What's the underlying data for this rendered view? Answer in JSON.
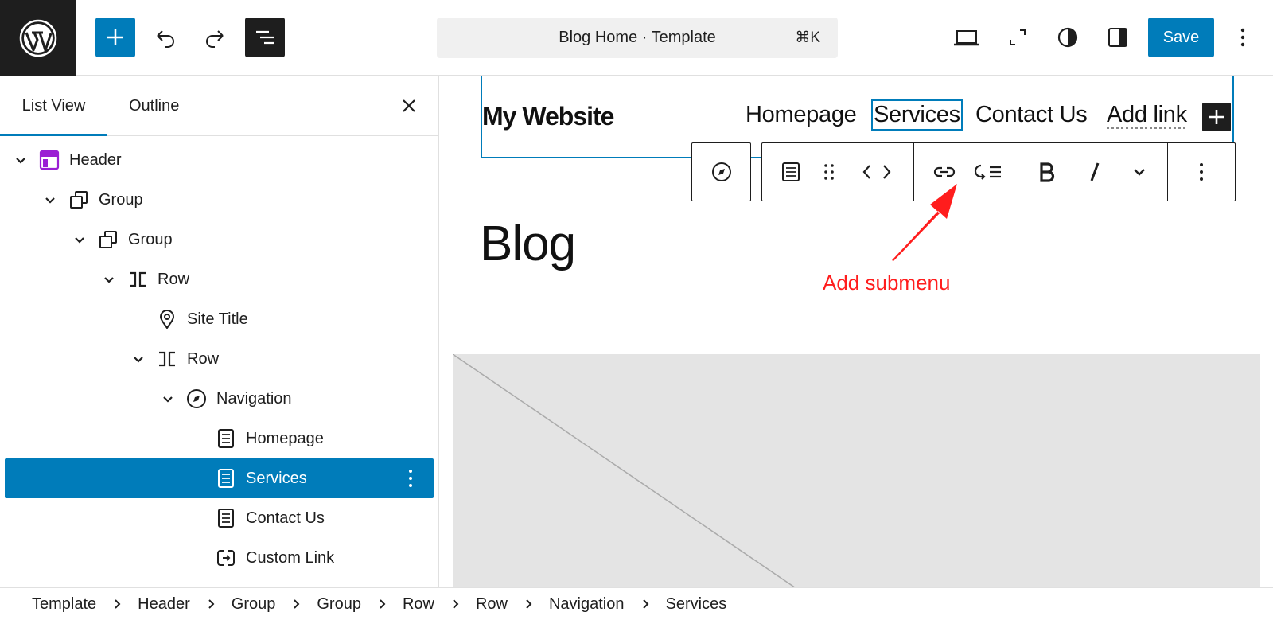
{
  "topbar": {
    "logo": "wordpress-logo",
    "inserter_icon": "plus-icon",
    "undo_icon": "undo-icon",
    "redo_icon": "redo-icon",
    "list_view_icon": "list-view-icon",
    "document_title": "Blog Home · Template",
    "shortcut": "⌘K",
    "device_icon": "desktop-device-icon",
    "zoom_icon": "fullscreen-icon",
    "styles_icon": "styles-contrast-icon",
    "settings_icon": "sidebar-settings-icon",
    "save_label": "Save",
    "options_icon": "kebab-menu-icon"
  },
  "sidebar": {
    "tabs": [
      {
        "label": "List View",
        "active": true
      },
      {
        "label": "Outline",
        "active": false
      }
    ],
    "close_icon": "close-icon",
    "tree": [
      {
        "label": "Header",
        "icon": "header-template-part-icon",
        "expanded": true,
        "level": 0
      },
      {
        "label": "Group",
        "icon": "group-icon",
        "expanded": true,
        "level": 1
      },
      {
        "label": "Group",
        "icon": "group-icon",
        "expanded": true,
        "level": 2
      },
      {
        "label": "Row",
        "icon": "row-icon",
        "expanded": true,
        "level": 3
      },
      {
        "label": "Site Title",
        "icon": "map-pin-icon",
        "expanded": null,
        "level": 4
      },
      {
        "label": "Row",
        "icon": "row-icon",
        "expanded": true,
        "level": 4
      },
      {
        "label": "Navigation",
        "icon": "navigation-compass-icon",
        "expanded": true,
        "level": 5
      },
      {
        "label": "Homepage",
        "icon": "page-icon",
        "expanded": null,
        "level": 6
      },
      {
        "label": "Services",
        "icon": "page-icon",
        "expanded": null,
        "level": 6,
        "selected": true
      },
      {
        "label": "Contact Us",
        "icon": "page-icon",
        "expanded": null,
        "level": 6
      },
      {
        "label": "Custom Link",
        "icon": "custom-link-icon",
        "expanded": null,
        "level": 6
      }
    ]
  },
  "canvas": {
    "site_title": "My Website",
    "nav_items": [
      "Homepage",
      "Services",
      "Contact Us",
      "Add link"
    ],
    "selected_nav_item": "Services",
    "nav_add_icon": "plus-icon",
    "toolbar_icons": [
      "navigation-compass-icon",
      "page-icon",
      "drag-handle-icon",
      "code-arrows-icon",
      "link-icon",
      "add-submenu-icon",
      "bold-icon",
      "italic-icon",
      "chevron-down-icon",
      "kebab-menu-icon"
    ],
    "heading": "Blog",
    "annotation": "Add submenu",
    "annotation_color": "#ff1d1d"
  },
  "breadcrumb": [
    "Template",
    "Header",
    "Group",
    "Group",
    "Row",
    "Row",
    "Navigation",
    "Services"
  ],
  "colors": {
    "accent": "#007cba",
    "dark": "#1e1e1e",
    "template_part": "#9b1ed4",
    "placeholder_bg": "#e4e4e4"
  }
}
